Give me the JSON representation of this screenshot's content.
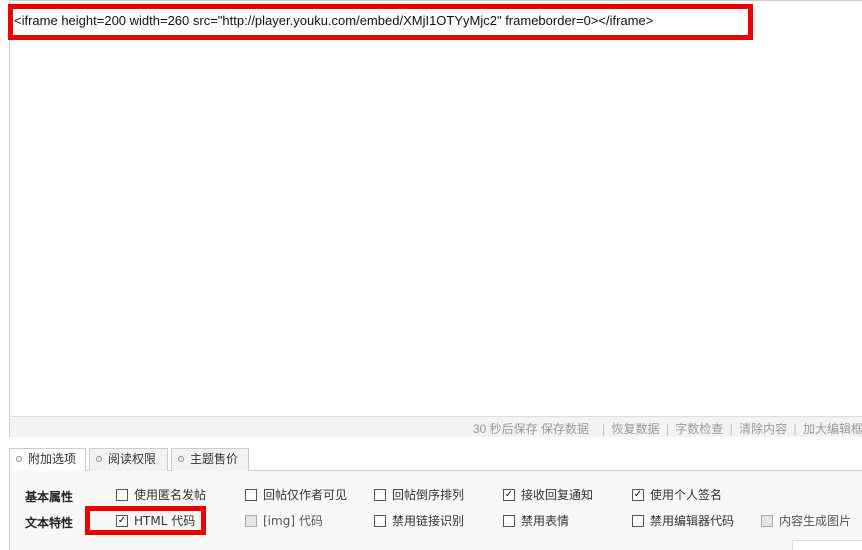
{
  "editor": {
    "content": "<iframe height=200 width=260 src=\"http://player.youku.com/embed/XMjI1OTYyMjc2\" frameborder=0></iframe>"
  },
  "status_bar": {
    "autosave": "30 秒后保存 保存数据",
    "links": [
      "恢复数据",
      "字数检查",
      "清除内容",
      "加大编辑框"
    ]
  },
  "tabs": [
    {
      "label": "附加选项",
      "active": true
    },
    {
      "label": "阅读权限",
      "active": false
    },
    {
      "label": "主题售价",
      "active": false
    }
  ],
  "options": {
    "row1_label": "基本属性",
    "row2_label": "文本特性",
    "row1": [
      {
        "label": "使用匿名发帖",
        "checked": false,
        "disabled": false
      },
      {
        "label": "回帖仅作者可见",
        "checked": false,
        "disabled": false
      },
      {
        "label": "回帖倒序排列",
        "checked": false,
        "disabled": false
      },
      {
        "label": "接收回复通知",
        "checked": true,
        "disabled": false
      },
      {
        "label": "使用个人签名",
        "checked": true,
        "disabled": false
      }
    ],
    "row2": [
      {
        "label": "HTML 代码",
        "checked": true,
        "disabled": false
      },
      {
        "label": "[img] 代码",
        "checked": false,
        "disabled": true
      },
      {
        "label": "禁用链接识别",
        "checked": false,
        "disabled": false
      },
      {
        "label": "禁用表情",
        "checked": false,
        "disabled": false
      },
      {
        "label": "禁用编辑器代码",
        "checked": false,
        "disabled": false
      },
      {
        "label": "内容生成图片",
        "checked": false,
        "disabled": true
      }
    ]
  },
  "highlight_color": "#ee0000"
}
